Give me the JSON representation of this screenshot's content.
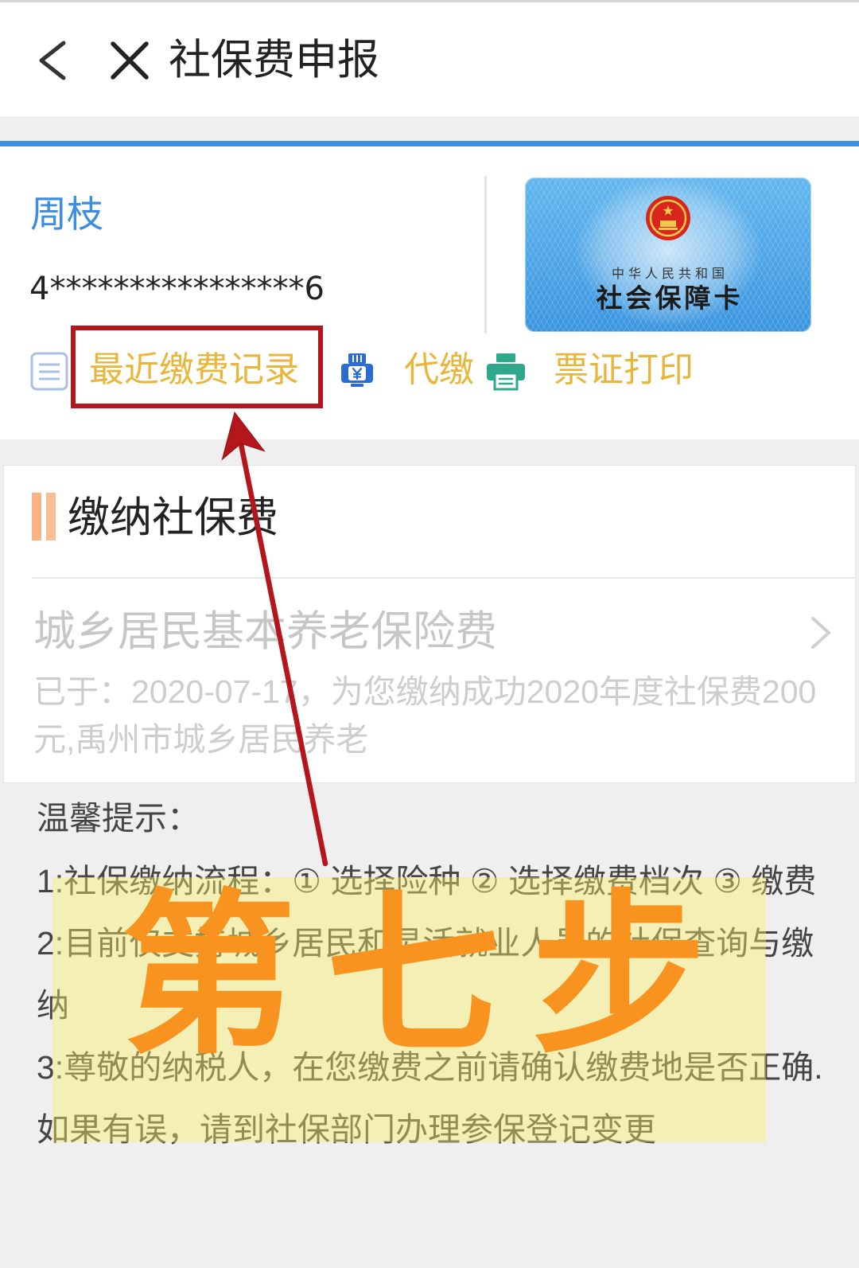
{
  "header": {
    "title": "社保费申报",
    "back_icon": "chevron-left-icon",
    "close_icon": "close-icon"
  },
  "theme": {
    "accent_blue": "#3d8fe3",
    "name_blue": "#3a8de0",
    "link_gold": "#e8b63c",
    "section_bar_orange": "#f7b383",
    "annotation_red": "#b5161c",
    "annotation_orange": "#f7931e",
    "highlight_yellow": "#faee64"
  },
  "user": {
    "name": "周枝",
    "id_masked": "4****************6"
  },
  "card": {
    "issuer": "中华人民共和国",
    "title": "社会保障卡",
    "emblem_icon": "national-emblem-icon"
  },
  "actions": [
    {
      "label": "最近缴费记录",
      "icon": "list-icon"
    },
    {
      "label": "代缴",
      "icon": "payment-icon"
    },
    {
      "label": "票证打印",
      "icon": "printer-icon"
    }
  ],
  "pay_section": {
    "title": "缴纳社保费",
    "item": {
      "name": "城乡居民基本养老保险费",
      "status_lines": [
        "已于：2020-07-17，为您缴纳成功2020年度社保费200",
        "元,禹州市城乡居民养老"
      ],
      "icon": "chevron-right-icon"
    }
  },
  "tips": {
    "heading": "温馨提示：",
    "items": [
      {
        "lines": [
          "1:社保缴纳流程：① 选择险种 ② 选择缴费档次 ③ 缴费"
        ]
      },
      {
        "lines": [
          "2:目前仅支持城乡居民和灵活就业人员的社保查询与缴",
          "纳"
        ]
      },
      {
        "lines": [
          "3:尊敬的纳税人，在您缴费之前请确认缴费地是否正确.",
          "如果有误，请到社保部门办理参保登记变更"
        ]
      }
    ]
  },
  "annotation": {
    "step_label": "第七步"
  }
}
